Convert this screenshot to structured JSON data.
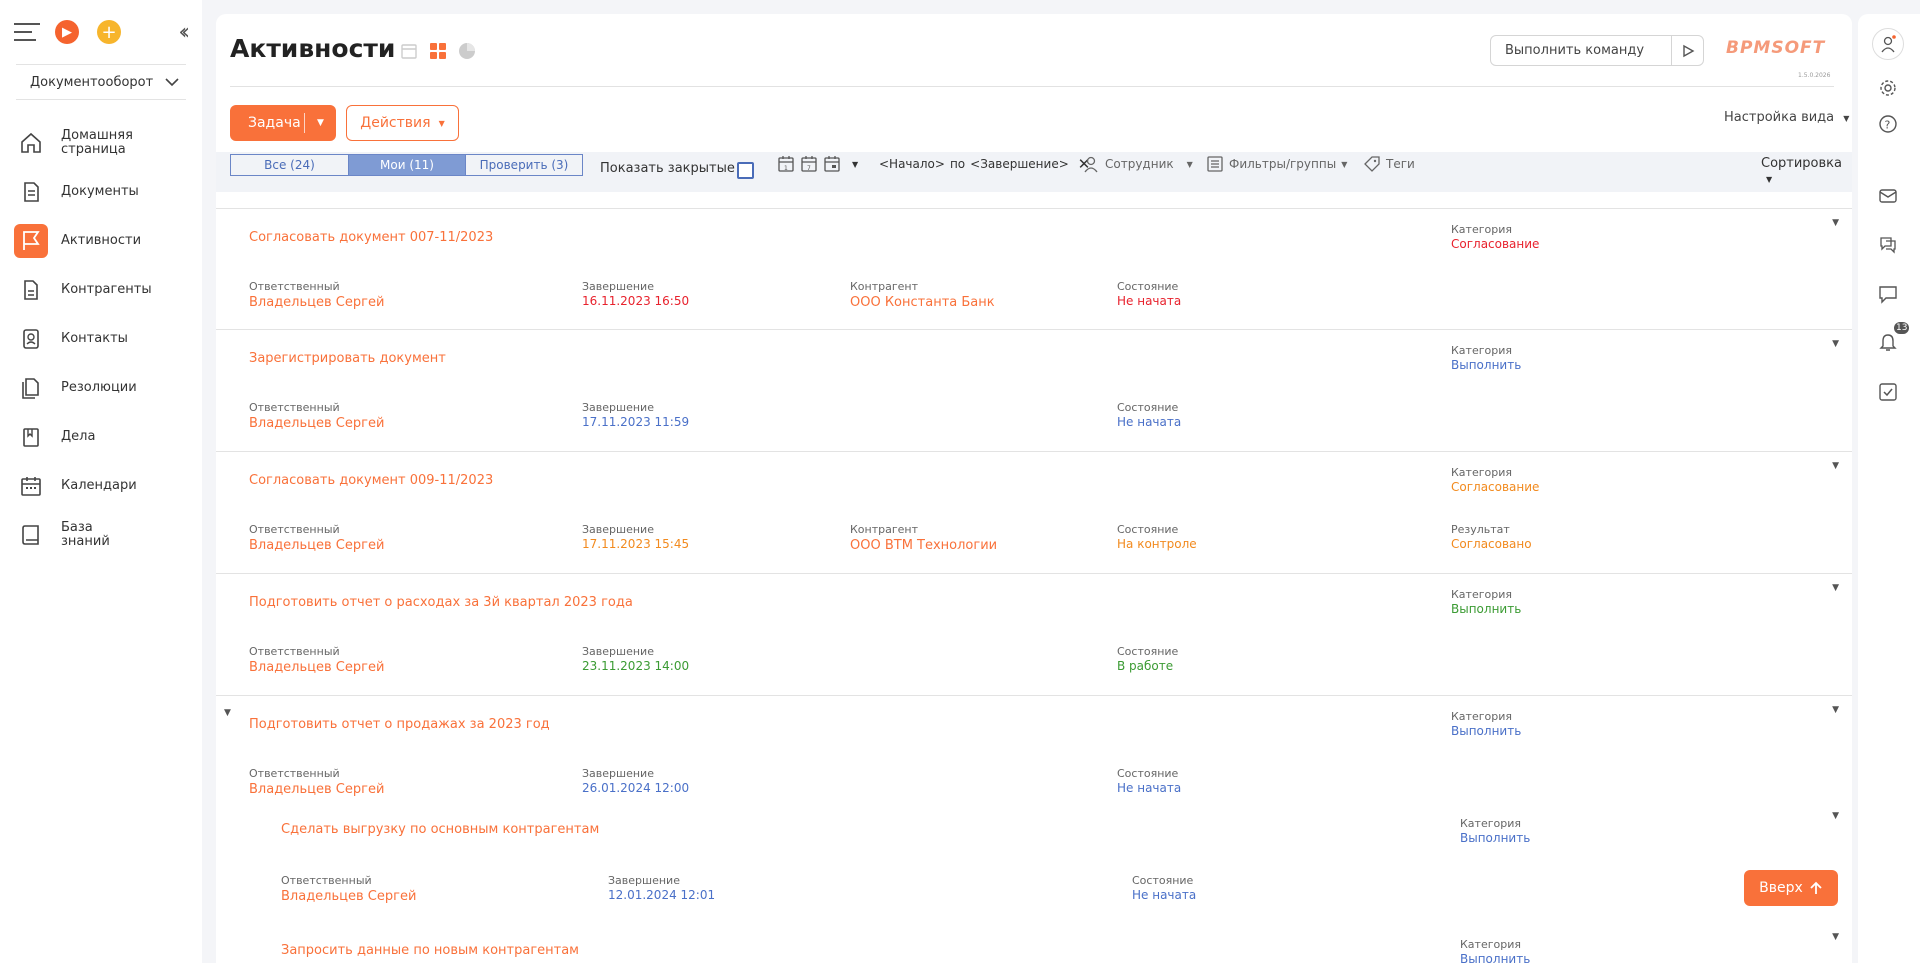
{
  "sidebar": {
    "section": "Документооборот",
    "items": [
      {
        "label": "Домашняя страница",
        "icon": "home-icon"
      },
      {
        "label": "Документы",
        "icon": "documents-icon"
      },
      {
        "label": "Активности",
        "icon": "flag-icon",
        "active": true
      },
      {
        "label": "Контрагенты",
        "icon": "accounts-icon"
      },
      {
        "label": "Контакты",
        "icon": "contacts-icon"
      },
      {
        "label": "Резолюции",
        "icon": "resolutions-icon"
      },
      {
        "label": "Дела",
        "icon": "cases-icon"
      },
      {
        "label": "Календари",
        "icon": "calendar-icon"
      },
      {
        "label": "База знаний",
        "icon": "knowledge-base-icon"
      }
    ]
  },
  "header": {
    "title": "Активности",
    "command_placeholder": "Выполнить команду",
    "logo": "BPMSOFT",
    "version": "1.5.0.2026"
  },
  "toolbar": {
    "task_label": "Задача",
    "actions_label": "Действия",
    "view_settings": "Настройка вида"
  },
  "filters": {
    "tabs": [
      "Все (24)",
      "Мои (11)",
      "Проверить (3)"
    ],
    "active_tab": 1,
    "show_closed": "Показать закрытые",
    "period_start": "<Начало>",
    "period_by": "по",
    "period_end": "<Завершение>",
    "employee": "Сотрудник",
    "filters_groups": "Фильтры/группы",
    "tags": "Теги",
    "sort": "Сортировка"
  },
  "labels": {
    "owner": "Ответственный",
    "due": "Завершение",
    "account": "Контрагент",
    "status": "Состояние",
    "category": "Категория",
    "result": "Результат"
  },
  "records": [
    {
      "title": "Согласовать документ 007-11/2023",
      "owner": "Владельцев Сергей",
      "due": "16.11.2023 16:50",
      "account": "ООО Константа Банк",
      "status": "Не начата",
      "category": "Согласование",
      "color": "red"
    },
    {
      "title": "Зарегистрировать документ",
      "owner": "Владельцев Сергей",
      "due": "17.11.2023 11:59",
      "status": "Не начата",
      "category": "Выполнить",
      "color": "blue"
    },
    {
      "title": "Согласовать документ 009-11/2023",
      "owner": "Владельцев Сергей",
      "due": "17.11.2023 15:45",
      "account": "ООО BTM Технологии",
      "status": "На контроле",
      "category": "Согласование",
      "result": "Согласовано",
      "color": "orange"
    },
    {
      "title": "Подготовить отчет о расходах за 3й квартал 2023 года",
      "owner": "Владельцев Сергей",
      "due": "23.11.2023 14:00",
      "status": "В работе",
      "category": "Выполнить",
      "color": "green"
    },
    {
      "title": "Подготовить отчет о продажах за 2023 год",
      "owner": "Владельцев Сергей",
      "due": "26.01.2024 12:00",
      "status": "Не начата",
      "category": "Выполнить",
      "color": "blue"
    }
  ],
  "children": [
    {
      "title": "Сделать выгрузку по основным контрагентам",
      "owner": "Владельцев Сергей",
      "due": "12.01.2024 12:01",
      "status": "Не начата",
      "category": "Выполнить"
    },
    {
      "title": "Запросить данные по новым контрагентам",
      "category": "Выполнить"
    }
  ],
  "up_button": "Вверх",
  "notifications_count": "13"
}
